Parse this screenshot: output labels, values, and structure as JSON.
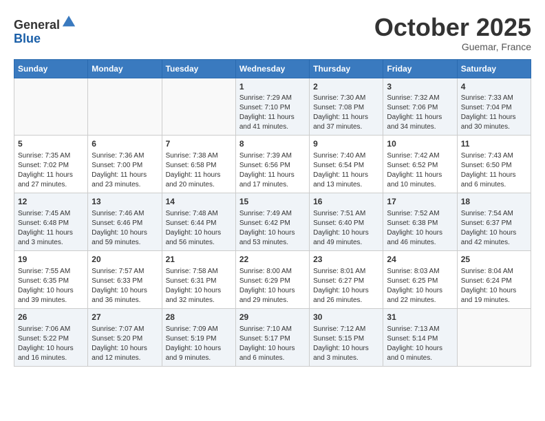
{
  "header": {
    "logo_line1": "General",
    "logo_line2": "Blue",
    "month": "October 2025",
    "location": "Guemar, France"
  },
  "days_of_week": [
    "Sunday",
    "Monday",
    "Tuesday",
    "Wednesday",
    "Thursday",
    "Friday",
    "Saturday"
  ],
  "weeks": [
    [
      {
        "day": "",
        "info": ""
      },
      {
        "day": "",
        "info": ""
      },
      {
        "day": "",
        "info": ""
      },
      {
        "day": "1",
        "info": "Sunrise: 7:29 AM\nSunset: 7:10 PM\nDaylight: 11 hours\nand 41 minutes."
      },
      {
        "day": "2",
        "info": "Sunrise: 7:30 AM\nSunset: 7:08 PM\nDaylight: 11 hours\nand 37 minutes."
      },
      {
        "day": "3",
        "info": "Sunrise: 7:32 AM\nSunset: 7:06 PM\nDaylight: 11 hours\nand 34 minutes."
      },
      {
        "day": "4",
        "info": "Sunrise: 7:33 AM\nSunset: 7:04 PM\nDaylight: 11 hours\nand 30 minutes."
      }
    ],
    [
      {
        "day": "5",
        "info": "Sunrise: 7:35 AM\nSunset: 7:02 PM\nDaylight: 11 hours\nand 27 minutes."
      },
      {
        "day": "6",
        "info": "Sunrise: 7:36 AM\nSunset: 7:00 PM\nDaylight: 11 hours\nand 23 minutes."
      },
      {
        "day": "7",
        "info": "Sunrise: 7:38 AM\nSunset: 6:58 PM\nDaylight: 11 hours\nand 20 minutes."
      },
      {
        "day": "8",
        "info": "Sunrise: 7:39 AM\nSunset: 6:56 PM\nDaylight: 11 hours\nand 17 minutes."
      },
      {
        "day": "9",
        "info": "Sunrise: 7:40 AM\nSunset: 6:54 PM\nDaylight: 11 hours\nand 13 minutes."
      },
      {
        "day": "10",
        "info": "Sunrise: 7:42 AM\nSunset: 6:52 PM\nDaylight: 11 hours\nand 10 minutes."
      },
      {
        "day": "11",
        "info": "Sunrise: 7:43 AM\nSunset: 6:50 PM\nDaylight: 11 hours\nand 6 minutes."
      }
    ],
    [
      {
        "day": "12",
        "info": "Sunrise: 7:45 AM\nSunset: 6:48 PM\nDaylight: 11 hours\nand 3 minutes."
      },
      {
        "day": "13",
        "info": "Sunrise: 7:46 AM\nSunset: 6:46 PM\nDaylight: 10 hours\nand 59 minutes."
      },
      {
        "day": "14",
        "info": "Sunrise: 7:48 AM\nSunset: 6:44 PM\nDaylight: 10 hours\nand 56 minutes."
      },
      {
        "day": "15",
        "info": "Sunrise: 7:49 AM\nSunset: 6:42 PM\nDaylight: 10 hours\nand 53 minutes."
      },
      {
        "day": "16",
        "info": "Sunrise: 7:51 AM\nSunset: 6:40 PM\nDaylight: 10 hours\nand 49 minutes."
      },
      {
        "day": "17",
        "info": "Sunrise: 7:52 AM\nSunset: 6:38 PM\nDaylight: 10 hours\nand 46 minutes."
      },
      {
        "day": "18",
        "info": "Sunrise: 7:54 AM\nSunset: 6:37 PM\nDaylight: 10 hours\nand 42 minutes."
      }
    ],
    [
      {
        "day": "19",
        "info": "Sunrise: 7:55 AM\nSunset: 6:35 PM\nDaylight: 10 hours\nand 39 minutes."
      },
      {
        "day": "20",
        "info": "Sunrise: 7:57 AM\nSunset: 6:33 PM\nDaylight: 10 hours\nand 36 minutes."
      },
      {
        "day": "21",
        "info": "Sunrise: 7:58 AM\nSunset: 6:31 PM\nDaylight: 10 hours\nand 32 minutes."
      },
      {
        "day": "22",
        "info": "Sunrise: 8:00 AM\nSunset: 6:29 PM\nDaylight: 10 hours\nand 29 minutes."
      },
      {
        "day": "23",
        "info": "Sunrise: 8:01 AM\nSunset: 6:27 PM\nDaylight: 10 hours\nand 26 minutes."
      },
      {
        "day": "24",
        "info": "Sunrise: 8:03 AM\nSunset: 6:25 PM\nDaylight: 10 hours\nand 22 minutes."
      },
      {
        "day": "25",
        "info": "Sunrise: 8:04 AM\nSunset: 6:24 PM\nDaylight: 10 hours\nand 19 minutes."
      }
    ],
    [
      {
        "day": "26",
        "info": "Sunrise: 7:06 AM\nSunset: 5:22 PM\nDaylight: 10 hours\nand 16 minutes."
      },
      {
        "day": "27",
        "info": "Sunrise: 7:07 AM\nSunset: 5:20 PM\nDaylight: 10 hours\nand 12 minutes."
      },
      {
        "day": "28",
        "info": "Sunrise: 7:09 AM\nSunset: 5:19 PM\nDaylight: 10 hours\nand 9 minutes."
      },
      {
        "day": "29",
        "info": "Sunrise: 7:10 AM\nSunset: 5:17 PM\nDaylight: 10 hours\nand 6 minutes."
      },
      {
        "day": "30",
        "info": "Sunrise: 7:12 AM\nSunset: 5:15 PM\nDaylight: 10 hours\nand 3 minutes."
      },
      {
        "day": "31",
        "info": "Sunrise: 7:13 AM\nSunset: 5:14 PM\nDaylight: 10 hours\nand 0 minutes."
      },
      {
        "day": "",
        "info": ""
      }
    ]
  ]
}
